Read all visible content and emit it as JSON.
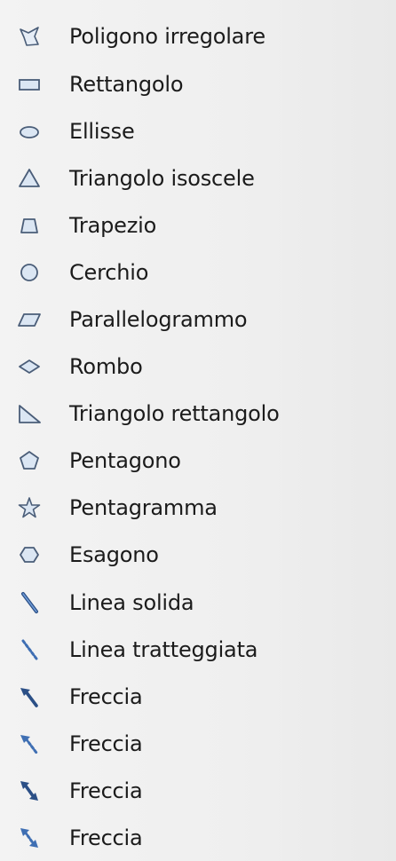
{
  "shape_list": {
    "items": [
      {
        "label": "Poligono irregolare",
        "icon": "irregular-polygon-icon"
      },
      {
        "label": "Rettangolo",
        "icon": "rectangle-icon"
      },
      {
        "label": "Ellisse",
        "icon": "ellipse-icon"
      },
      {
        "label": "Triangolo isoscele",
        "icon": "isosceles-triangle-icon"
      },
      {
        "label": "Trapezio",
        "icon": "trapezoid-icon"
      },
      {
        "label": "Cerchio",
        "icon": "circle-icon"
      },
      {
        "label": "Parallelogrammo",
        "icon": "parallelogram-icon"
      },
      {
        "label": "Rombo",
        "icon": "rhombus-icon"
      },
      {
        "label": "Triangolo rettangolo",
        "icon": "right-triangle-icon"
      },
      {
        "label": "Pentagono",
        "icon": "pentagon-icon"
      },
      {
        "label": "Pentagramma",
        "icon": "pentagram-icon"
      },
      {
        "label": "Esagono",
        "icon": "hexagon-icon"
      },
      {
        "label": "Linea solida",
        "icon": "solid-line-icon"
      },
      {
        "label": "Linea tratteggiata",
        "icon": "dashed-line-icon"
      },
      {
        "label": "Freccia",
        "icon": "arrow-icon"
      },
      {
        "label": "Freccia",
        "icon": "dashed-arrow-icon"
      },
      {
        "label": "Freccia",
        "icon": "double-arrow-icon"
      },
      {
        "label": "Freccia",
        "icon": "dashed-double-arrow-icon"
      }
    ]
  },
  "colors": {
    "icon_fill": "#dbe6f3",
    "icon_stroke": "#4a5d78",
    "line_blue": "#3f6fb3",
    "text": "#1b1b1b"
  }
}
